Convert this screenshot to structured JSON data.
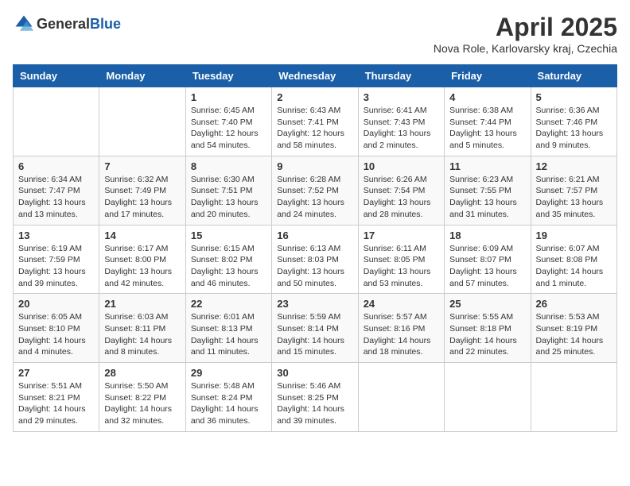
{
  "header": {
    "logo_general": "General",
    "logo_blue": "Blue",
    "month": "April 2025",
    "location": "Nova Role, Karlovarsky kraj, Czechia"
  },
  "weekdays": [
    "Sunday",
    "Monday",
    "Tuesday",
    "Wednesday",
    "Thursday",
    "Friday",
    "Saturday"
  ],
  "weeks": [
    [
      {
        "day": "",
        "info": ""
      },
      {
        "day": "",
        "info": ""
      },
      {
        "day": "1",
        "info": "Sunrise: 6:45 AM\nSunset: 7:40 PM\nDaylight: 12 hours and 54 minutes."
      },
      {
        "day": "2",
        "info": "Sunrise: 6:43 AM\nSunset: 7:41 PM\nDaylight: 12 hours and 58 minutes."
      },
      {
        "day": "3",
        "info": "Sunrise: 6:41 AM\nSunset: 7:43 PM\nDaylight: 13 hours and 2 minutes."
      },
      {
        "day": "4",
        "info": "Sunrise: 6:38 AM\nSunset: 7:44 PM\nDaylight: 13 hours and 5 minutes."
      },
      {
        "day": "5",
        "info": "Sunrise: 6:36 AM\nSunset: 7:46 PM\nDaylight: 13 hours and 9 minutes."
      }
    ],
    [
      {
        "day": "6",
        "info": "Sunrise: 6:34 AM\nSunset: 7:47 PM\nDaylight: 13 hours and 13 minutes."
      },
      {
        "day": "7",
        "info": "Sunrise: 6:32 AM\nSunset: 7:49 PM\nDaylight: 13 hours and 17 minutes."
      },
      {
        "day": "8",
        "info": "Sunrise: 6:30 AM\nSunset: 7:51 PM\nDaylight: 13 hours and 20 minutes."
      },
      {
        "day": "9",
        "info": "Sunrise: 6:28 AM\nSunset: 7:52 PM\nDaylight: 13 hours and 24 minutes."
      },
      {
        "day": "10",
        "info": "Sunrise: 6:26 AM\nSunset: 7:54 PM\nDaylight: 13 hours and 28 minutes."
      },
      {
        "day": "11",
        "info": "Sunrise: 6:23 AM\nSunset: 7:55 PM\nDaylight: 13 hours and 31 minutes."
      },
      {
        "day": "12",
        "info": "Sunrise: 6:21 AM\nSunset: 7:57 PM\nDaylight: 13 hours and 35 minutes."
      }
    ],
    [
      {
        "day": "13",
        "info": "Sunrise: 6:19 AM\nSunset: 7:59 PM\nDaylight: 13 hours and 39 minutes."
      },
      {
        "day": "14",
        "info": "Sunrise: 6:17 AM\nSunset: 8:00 PM\nDaylight: 13 hours and 42 minutes."
      },
      {
        "day": "15",
        "info": "Sunrise: 6:15 AM\nSunset: 8:02 PM\nDaylight: 13 hours and 46 minutes."
      },
      {
        "day": "16",
        "info": "Sunrise: 6:13 AM\nSunset: 8:03 PM\nDaylight: 13 hours and 50 minutes."
      },
      {
        "day": "17",
        "info": "Sunrise: 6:11 AM\nSunset: 8:05 PM\nDaylight: 13 hours and 53 minutes."
      },
      {
        "day": "18",
        "info": "Sunrise: 6:09 AM\nSunset: 8:07 PM\nDaylight: 13 hours and 57 minutes."
      },
      {
        "day": "19",
        "info": "Sunrise: 6:07 AM\nSunset: 8:08 PM\nDaylight: 14 hours and 1 minute."
      }
    ],
    [
      {
        "day": "20",
        "info": "Sunrise: 6:05 AM\nSunset: 8:10 PM\nDaylight: 14 hours and 4 minutes."
      },
      {
        "day": "21",
        "info": "Sunrise: 6:03 AM\nSunset: 8:11 PM\nDaylight: 14 hours and 8 minutes."
      },
      {
        "day": "22",
        "info": "Sunrise: 6:01 AM\nSunset: 8:13 PM\nDaylight: 14 hours and 11 minutes."
      },
      {
        "day": "23",
        "info": "Sunrise: 5:59 AM\nSunset: 8:14 PM\nDaylight: 14 hours and 15 minutes."
      },
      {
        "day": "24",
        "info": "Sunrise: 5:57 AM\nSunset: 8:16 PM\nDaylight: 14 hours and 18 minutes."
      },
      {
        "day": "25",
        "info": "Sunrise: 5:55 AM\nSunset: 8:18 PM\nDaylight: 14 hours and 22 minutes."
      },
      {
        "day": "26",
        "info": "Sunrise: 5:53 AM\nSunset: 8:19 PM\nDaylight: 14 hours and 25 minutes."
      }
    ],
    [
      {
        "day": "27",
        "info": "Sunrise: 5:51 AM\nSunset: 8:21 PM\nDaylight: 14 hours and 29 minutes."
      },
      {
        "day": "28",
        "info": "Sunrise: 5:50 AM\nSunset: 8:22 PM\nDaylight: 14 hours and 32 minutes."
      },
      {
        "day": "29",
        "info": "Sunrise: 5:48 AM\nSunset: 8:24 PM\nDaylight: 14 hours and 36 minutes."
      },
      {
        "day": "30",
        "info": "Sunrise: 5:46 AM\nSunset: 8:25 PM\nDaylight: 14 hours and 39 minutes."
      },
      {
        "day": "",
        "info": ""
      },
      {
        "day": "",
        "info": ""
      },
      {
        "day": "",
        "info": ""
      }
    ]
  ]
}
